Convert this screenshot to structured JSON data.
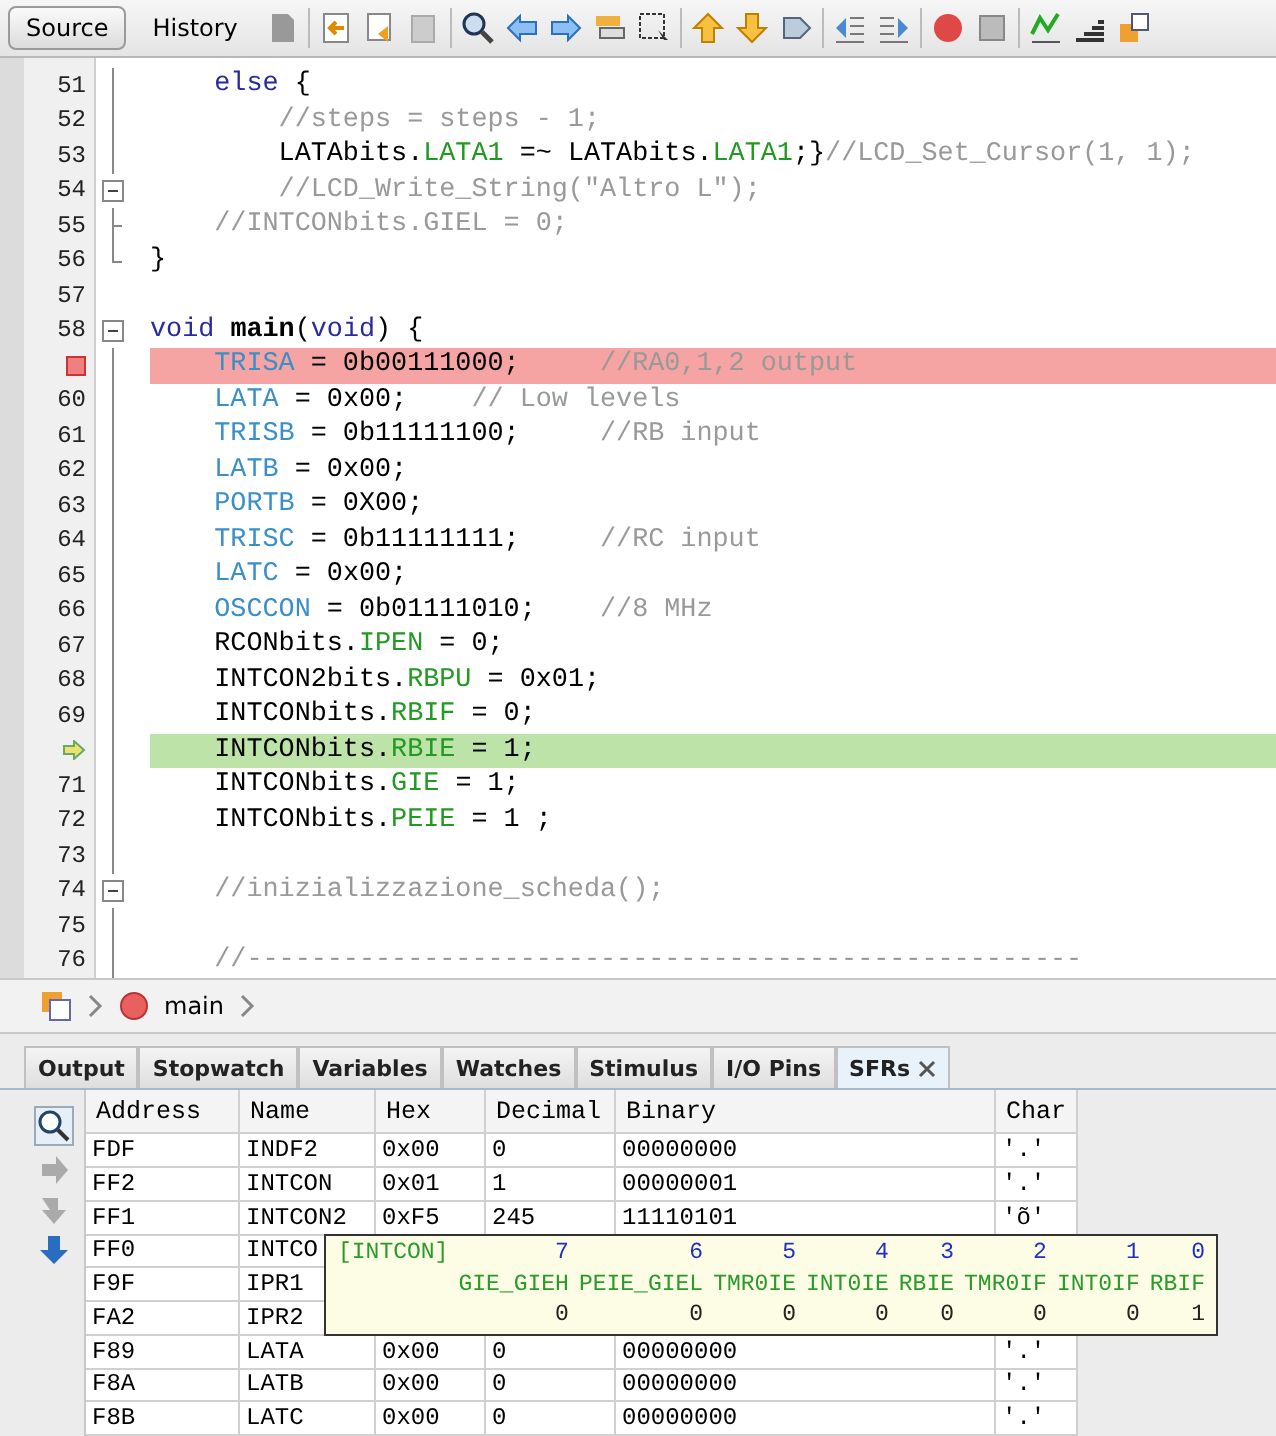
{
  "editor_tabs": [
    {
      "label": "Source",
      "selected": true
    },
    {
      "label": "History",
      "selected": false
    }
  ],
  "code_lines": [
    {
      "num": "51",
      "kind": "line",
      "breakpoint": false,
      "current": false,
      "segs": [
        {
          "kind": "kw",
          "t": "    else"
        },
        {
          "kind": "plain",
          "t": " {"
        }
      ]
    },
    {
      "num": "52",
      "kind": "line",
      "breakpoint": false,
      "current": false,
      "segs": [
        {
          "kind": "comment",
          "t": "        //steps = steps - 1;"
        }
      ]
    },
    {
      "num": "53",
      "kind": "line",
      "breakpoint": false,
      "current": false,
      "segs": [
        {
          "kind": "plain",
          "t": "        LATAbits."
        },
        {
          "kind": "field",
          "t": "LATA1"
        },
        {
          "kind": "plain",
          "t": " =~ LATAbits."
        },
        {
          "kind": "field",
          "t": "LATA1"
        },
        {
          "kind": "plain",
          "t": ";}"
        },
        {
          "kind": "comment",
          "t": "//LCD_Set_Cursor(1, 1);"
        }
      ]
    },
    {
      "num": "54",
      "kind": "collapse",
      "breakpoint": false,
      "current": false,
      "segs": [
        {
          "kind": "comment",
          "t": "        //LCD_Write_String(\"Altro L\");"
        }
      ]
    },
    {
      "num": "55",
      "kind": "tee",
      "breakpoint": false,
      "current": false,
      "segs": [
        {
          "kind": "comment",
          "t": "    //INTCONbits.GIEL = 0;"
        }
      ]
    },
    {
      "num": "56",
      "kind": "end",
      "breakpoint": false,
      "current": false,
      "segs": [
        {
          "kind": "plain",
          "t": "}"
        }
      ]
    },
    {
      "num": "57",
      "kind": "none",
      "breakpoint": false,
      "current": false
    },
    {
      "num": "58",
      "kind": "collapse",
      "breakpoint": false,
      "current": false,
      "segs": [
        {
          "kind": "kw",
          "t": "void"
        },
        {
          "kind": "fn",
          "t": " main"
        },
        {
          "kind": "plain",
          "t": "("
        },
        {
          "kind": "kw",
          "t": "void"
        },
        {
          "kind": "plain",
          "t": ") {"
        }
      ]
    },
    {
      "kind": "line",
      "breakpoint": true,
      "current": false,
      "segs": [
        {
          "kind": "sfr",
          "t": "    TRISA"
        },
        {
          "kind": "plain",
          "t": " = 0b00111000;"
        },
        {
          "kind": "comment",
          "t": "     //RA0,1,2 output"
        }
      ]
    },
    {
      "num": "60",
      "kind": "line",
      "breakpoint": false,
      "current": false,
      "segs": [
        {
          "kind": "sfr",
          "t": "    LATA"
        },
        {
          "kind": "plain",
          "t": " = 0x00;"
        },
        {
          "kind": "comment",
          "t": "    // Low levels"
        }
      ]
    },
    {
      "num": "61",
      "kind": "line",
      "breakpoint": false,
      "current": false,
      "segs": [
        {
          "kind": "sfr",
          "t": "    TRISB"
        },
        {
          "kind": "plain",
          "t": " = 0b11111100;"
        },
        {
          "kind": "comment",
          "t": "     //RB input"
        }
      ]
    },
    {
      "num": "62",
      "kind": "line",
      "breakpoint": false,
      "current": false,
      "segs": [
        {
          "kind": "sfr",
          "t": "    LATB"
        },
        {
          "kind": "plain",
          "t": " = 0x00;"
        }
      ]
    },
    {
      "num": "63",
      "kind": "line",
      "breakpoint": false,
      "current": false,
      "segs": [
        {
          "kind": "sfr",
          "t": "    PORTB"
        },
        {
          "kind": "plain",
          "t": " = 0X00;"
        }
      ]
    },
    {
      "num": "64",
      "kind": "line",
      "breakpoint": false,
      "current": false,
      "segs": [
        {
          "kind": "sfr",
          "t": "    TRISC"
        },
        {
          "kind": "plain",
          "t": " = 0b11111111;"
        },
        {
          "kind": "comment",
          "t": "     //RC input"
        }
      ]
    },
    {
      "num": "65",
      "kind": "line",
      "breakpoint": false,
      "current": false,
      "segs": [
        {
          "kind": "sfr",
          "t": "    LATC"
        },
        {
          "kind": "plain",
          "t": " = 0x00;"
        }
      ]
    },
    {
      "num": "66",
      "kind": "line",
      "breakpoint": false,
      "current": false,
      "segs": [
        {
          "kind": "sfr",
          "t": "    OSCCON"
        },
        {
          "kind": "plain",
          "t": " = 0b01111010;"
        },
        {
          "kind": "comment",
          "t": "    //8 MHz"
        }
      ]
    },
    {
      "num": "67",
      "kind": "line",
      "breakpoint": false,
      "current": false,
      "segs": [
        {
          "kind": "plain",
          "t": "    RCONbits."
        },
        {
          "kind": "field",
          "t": "IPEN"
        },
        {
          "kind": "plain",
          "t": " = 0;"
        }
      ]
    },
    {
      "num": "68",
      "kind": "line",
      "breakpoint": false,
      "current": false,
      "segs": [
        {
          "kind": "plain",
          "t": "    INTCON2bits."
        },
        {
          "kind": "field",
          "t": "RBPU"
        },
        {
          "kind": "plain",
          "t": " = 0x01;"
        }
      ]
    },
    {
      "num": "69",
      "kind": "line",
      "breakpoint": false,
      "current": false,
      "segs": [
        {
          "kind": "plain",
          "t": "    INTCONbits."
        },
        {
          "kind": "field",
          "t": "RBIF"
        },
        {
          "kind": "plain",
          "t": " = 0;"
        }
      ]
    },
    {
      "kind": "line",
      "breakpoint": false,
      "current": true,
      "segs": [
        {
          "kind": "plain",
          "t": "    INTCONbits."
        },
        {
          "kind": "field",
          "t": "RBIE"
        },
        {
          "kind": "plain",
          "t": " = 1;"
        }
      ]
    },
    {
      "num": "71",
      "kind": "line",
      "breakpoint": false,
      "current": false,
      "segs": [
        {
          "kind": "plain",
          "t": "    INTCONbits."
        },
        {
          "kind": "field",
          "t": "GIE"
        },
        {
          "kind": "plain",
          "t": " = 1;"
        }
      ]
    },
    {
      "num": "72",
      "kind": "line",
      "breakpoint": false,
      "current": false,
      "segs": [
        {
          "kind": "plain",
          "t": "    INTCONbits."
        },
        {
          "kind": "field",
          "t": "PEIE"
        },
        {
          "kind": "plain",
          "t": " = 1 ;"
        }
      ]
    },
    {
      "num": "73",
      "kind": "line",
      "breakpoint": false,
      "current": false
    },
    {
      "num": "74",
      "kind": "collapse",
      "breakpoint": false,
      "current": false,
      "segs": [
        {
          "kind": "comment",
          "t": "    //inizializzazione_scheda();"
        }
      ]
    },
    {
      "num": "75",
      "kind": "line",
      "breakpoint": false,
      "current": false
    },
    {
      "num": "76",
      "kind": "line",
      "breakpoint": false,
      "current": false,
      "segs": [
        {
          "kind": "comment",
          "t": "    //----------------------------------------------------"
        }
      ]
    }
  ],
  "breadcrumb": {
    "function": "main"
  },
  "panel_tabs": [
    {
      "label": "Output",
      "selected": false
    },
    {
      "label": "Stopwatch",
      "selected": false
    },
    {
      "label": "Variables",
      "selected": false
    },
    {
      "label": "Watches",
      "selected": false
    },
    {
      "label": "Stimulus",
      "selected": false
    },
    {
      "label": "I/O Pins",
      "selected": false
    },
    {
      "label": "SFRs",
      "selected": true
    }
  ],
  "sfr_table": {
    "columns": [
      "Address",
      "Name",
      "Hex",
      "Decimal",
      "Binary",
      "Char"
    ],
    "rows": [
      [
        "FDF",
        "INDF2",
        "0x00",
        "0",
        "00000000",
        "'.'"
      ],
      [
        "FF2",
        "INTCON",
        "0x01",
        "1",
        "00000001",
        "'.'"
      ],
      [
        "FF1",
        "INTCON2",
        "0xF5",
        "245",
        "11110101",
        "'õ'"
      ],
      [
        "FF0",
        "INTCO"
      ],
      [
        "F9F",
        "IPR1"
      ],
      [
        "FA2",
        "IPR2"
      ],
      [
        "F89",
        "LATA",
        "0x00",
        "0",
        "00000000",
        "'.'"
      ],
      [
        "F8A",
        "LATB",
        "0x00",
        "0",
        "00000000",
        "'.'"
      ],
      [
        "F8B",
        "LATC",
        "0x00",
        "0",
        "00000000",
        "'.'"
      ]
    ]
  },
  "tooltip": {
    "register": "[INTCON]",
    "bits": [
      {
        "bit": "7",
        "name": "GIE_GIEH",
        "value": "0"
      },
      {
        "bit": "6",
        "name": "PEIE_GIEL",
        "value": "0"
      },
      {
        "bit": "5",
        "name": "TMR0IE",
        "value": "0"
      },
      {
        "bit": "4",
        "name": "INT0IE",
        "value": "0"
      },
      {
        "bit": "3",
        "name": "RBIE",
        "value": "0"
      },
      {
        "bit": "2",
        "name": "TMR0IF",
        "value": "0"
      },
      {
        "bit": "1",
        "name": "INT0IF",
        "value": "0"
      },
      {
        "bit": "0",
        "name": "RBIF",
        "value": "1"
      }
    ]
  }
}
